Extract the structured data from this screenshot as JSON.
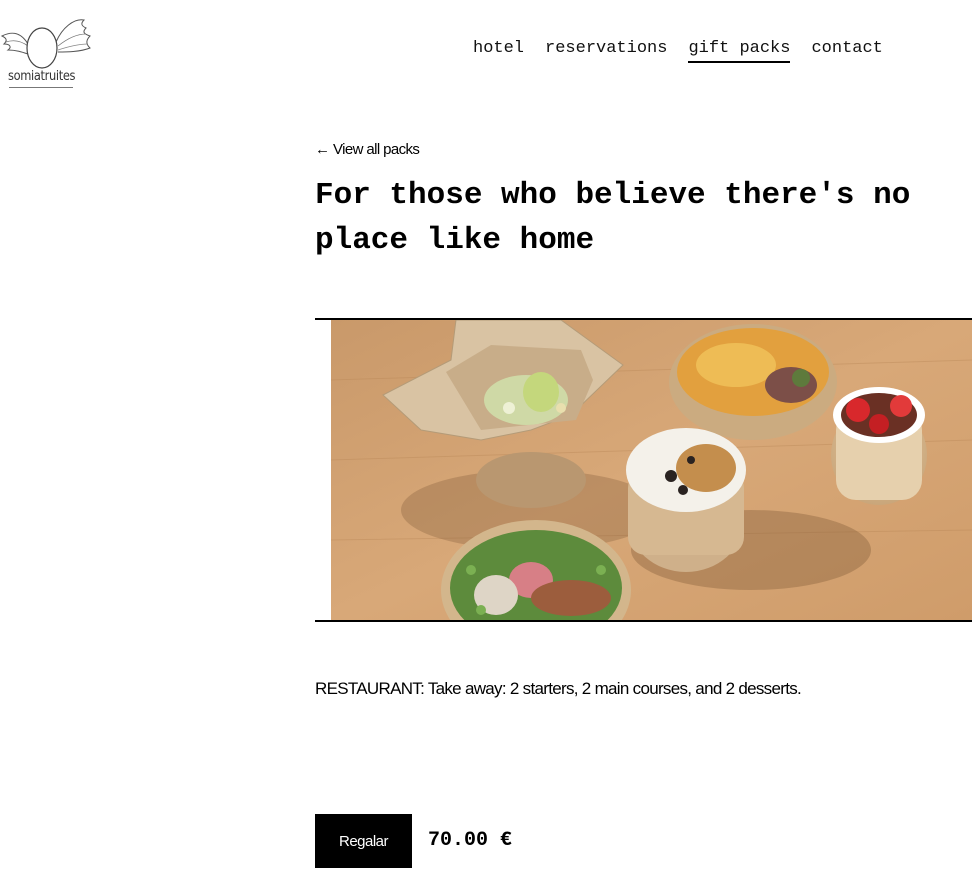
{
  "header": {
    "logo_text": "somiatruites",
    "nav": [
      {
        "label": "hotel",
        "active": false
      },
      {
        "label": "reservations",
        "active": false
      },
      {
        "label": "gift packs",
        "active": true
      },
      {
        "label": "contact",
        "active": false
      }
    ]
  },
  "main": {
    "back_link": "← View all packs",
    "title": "For those who believe there's no place like home",
    "image": {
      "subject": "take-away food boxes and bowls on a wooden table"
    },
    "description": "RESTAURANT: Take away: 2 starters, 2 main courses, and 2 desserts.",
    "gift_button": "Regalar",
    "price": "70.00 €"
  }
}
